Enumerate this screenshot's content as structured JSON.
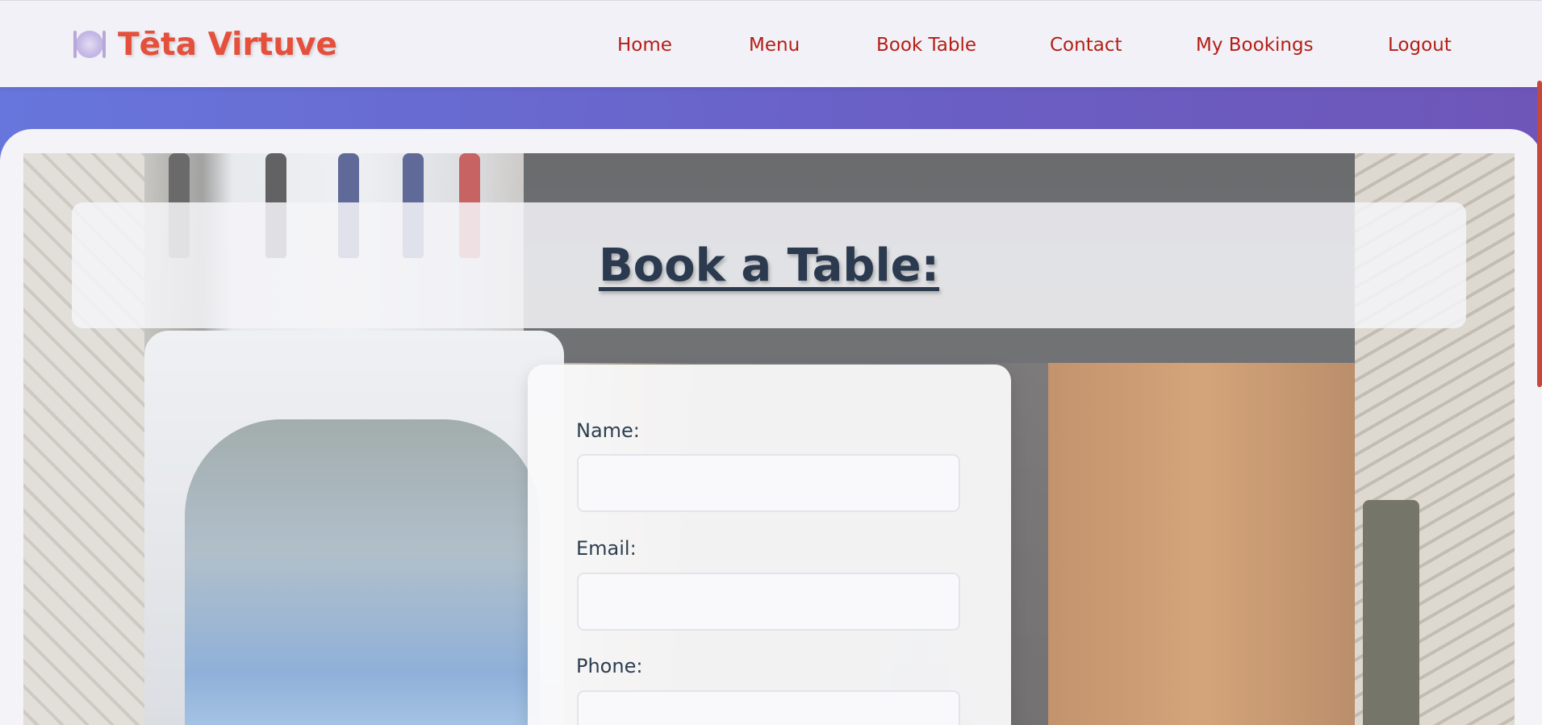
{
  "navbar": {
    "brand_icon": "plate-cutlery-icon",
    "brand_name": "Tēta Virtuve",
    "links": [
      {
        "label": "Home"
      },
      {
        "label": "Menu"
      },
      {
        "label": "Book Table"
      },
      {
        "label": "Contact"
      },
      {
        "label": "My Bookings"
      },
      {
        "label": "Logout"
      }
    ]
  },
  "main": {
    "title": "Book a Table:",
    "form": {
      "name_label": "Name:",
      "name_value": "",
      "email_label": "Email:",
      "email_value": "",
      "phone_label": "Phone:",
      "phone_value": ""
    }
  },
  "colors": {
    "brand": "#e4503b",
    "nav_link": "#b41e14",
    "title": "#2b3a4e",
    "label": "#2c3e50",
    "background_gradient_start": "#6776dc",
    "background_gradient_end": "#6e56b8"
  }
}
